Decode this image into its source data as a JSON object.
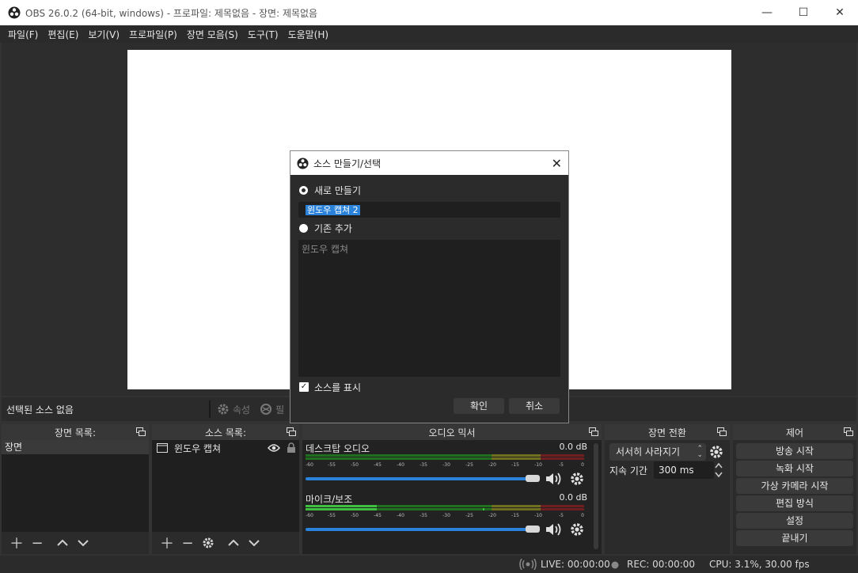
{
  "window": {
    "title": "OBS 26.0.2 (64-bit, windows) - 프로파일: 제목없음 - 장면: 제목없음",
    "minimize": "—",
    "maximize": "☐",
    "close": "✕"
  },
  "menu": [
    "파일(F)",
    "편집(E)",
    "보기(V)",
    "프로파일(P)",
    "장면 모음(S)",
    "도구(T)",
    "도움말(H)"
  ],
  "context": {
    "no_source": "선택된 소스 없음",
    "properties": "속성",
    "filters": "필"
  },
  "scenes": {
    "header": "장면 목록:",
    "items": [
      "장면"
    ]
  },
  "sources": {
    "header": "소스 목록:",
    "items": [
      "윈도우 캡쳐"
    ]
  },
  "mixer": {
    "header": "오디오 믹서",
    "ticks": [
      "-60",
      "-55",
      "-50",
      "-45",
      "-40",
      "-35",
      "-30",
      "-25",
      "-20",
      "-15",
      "-10",
      "-5",
      "0"
    ],
    "channels": [
      {
        "name": "데스크탑 오디오",
        "db": "0.0 dB",
        "volume": 0.95
      },
      {
        "name": "마이크/보조",
        "db": "0.0 dB",
        "volume": 0.95
      }
    ]
  },
  "transitions": {
    "header": "장면 전환",
    "selected": "서서히 사라지기",
    "duration_label": "지속 기간",
    "duration_value": "300 ms"
  },
  "controls": {
    "header": "제어",
    "buttons": [
      "방송 시작",
      "녹화 시작",
      "가상 카메라 시작",
      "편집 방식",
      "설정",
      "끝내기"
    ]
  },
  "status": {
    "live": "LIVE: 00:00:00",
    "rec": "REC: 00:00:00",
    "cpu": "CPU: 3.1%, 30.00 fps"
  },
  "dialog": {
    "title": "소스 만들기/선택",
    "create_new": "새로 만들기",
    "name_value": "윈도우 캡쳐 2",
    "add_existing": "기존 추가",
    "existing_items": [
      "윈도우 캡쳐"
    ],
    "show_source": "소스를 표시",
    "ok": "확인",
    "cancel": "취소"
  },
  "colors": {
    "accent": "#2a82da",
    "meter_green": "#3fbf3f",
    "meter_yellow": "#bfbf3f",
    "meter_red": "#bf3f3f"
  }
}
